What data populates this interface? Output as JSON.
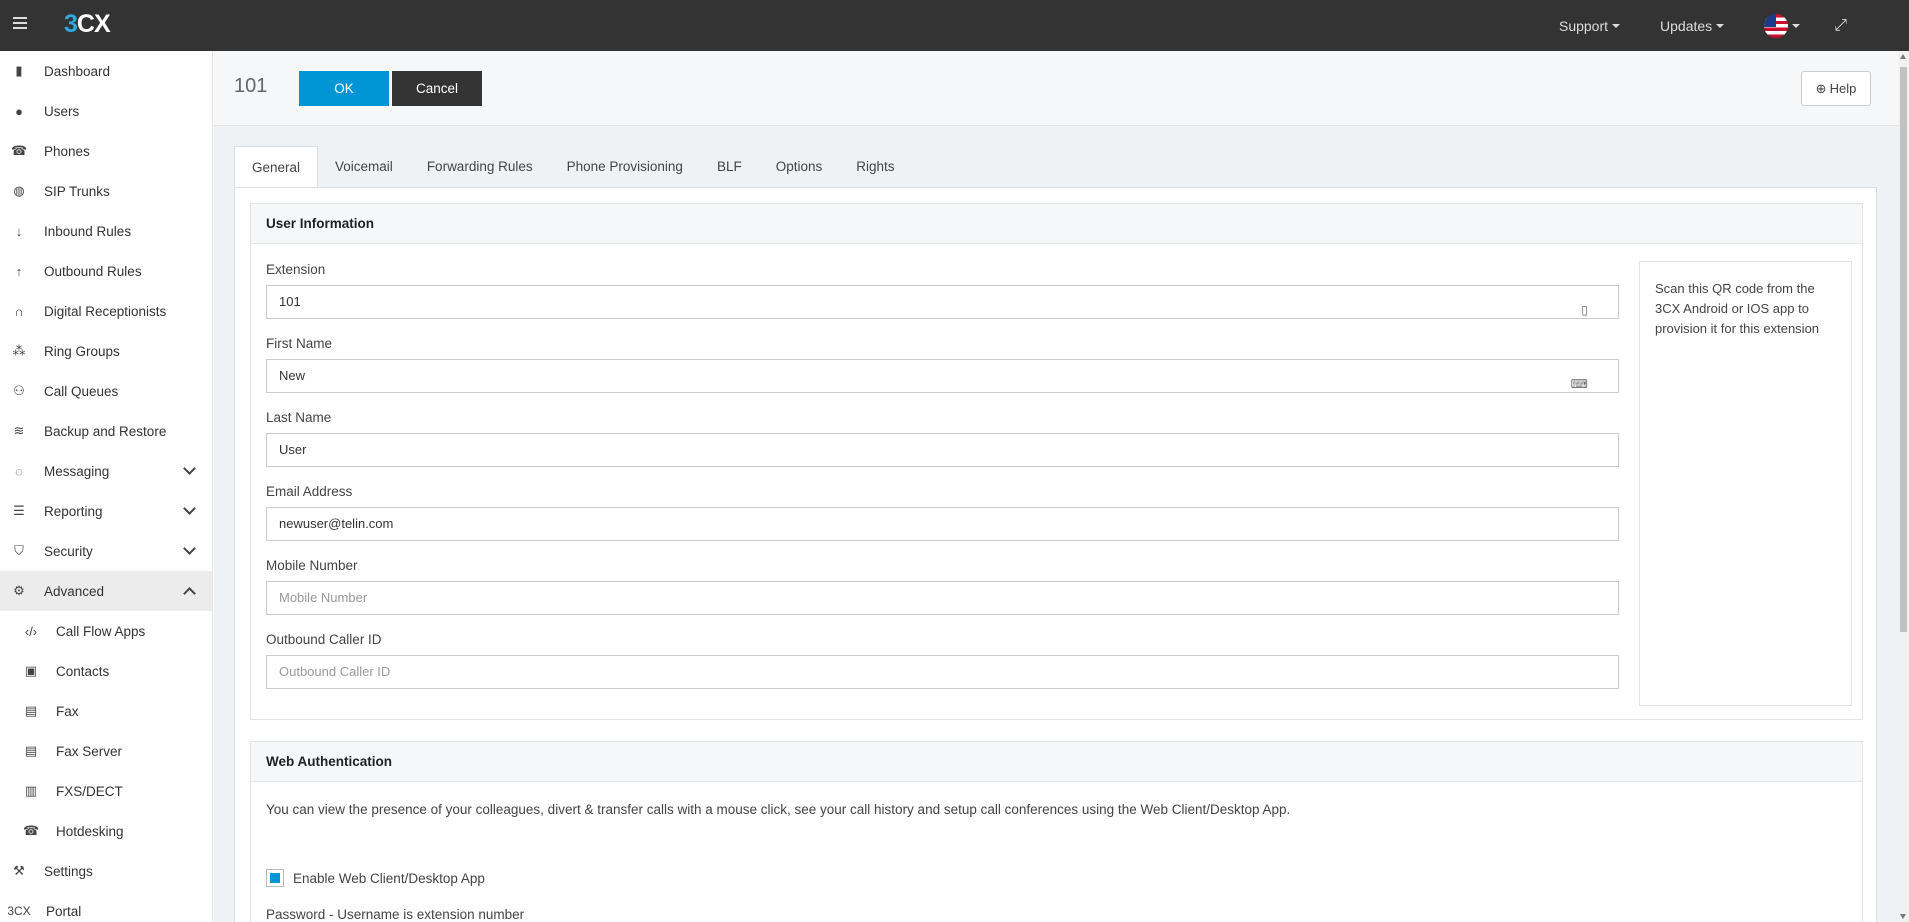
{
  "topbar": {
    "logo_prefix": "3",
    "logo_suffix": "CX",
    "support": "Support",
    "updates": "Updates"
  },
  "sidebar": {
    "items": [
      {
        "label": "Dashboard",
        "icon": "bar-chart-icon"
      },
      {
        "label": "Users",
        "icon": "user-icon"
      },
      {
        "label": "Phones",
        "icon": "phone-icon"
      },
      {
        "label": "SIP Trunks",
        "icon": "globe-icon"
      },
      {
        "label": "Inbound Rules",
        "icon": "arrow-down-icon"
      },
      {
        "label": "Outbound Rules",
        "icon": "arrow-up-icon"
      },
      {
        "label": "Digital Receptionists",
        "icon": "headset-icon"
      },
      {
        "label": "Ring Groups",
        "icon": "group-icon"
      },
      {
        "label": "Call Queues",
        "icon": "queue-icon"
      },
      {
        "label": "Backup and Restore",
        "icon": "database-icon"
      },
      {
        "label": "Messaging",
        "icon": "chat-icon"
      },
      {
        "label": "Reporting",
        "icon": "list-icon"
      },
      {
        "label": "Security",
        "icon": "shield-icon"
      },
      {
        "label": "Advanced",
        "icon": "gear-icon"
      },
      {
        "label": "Call Flow Apps",
        "icon": "code-icon"
      },
      {
        "label": "Contacts",
        "icon": "contact-book-icon"
      },
      {
        "label": "Fax",
        "icon": "fax-icon"
      },
      {
        "label": "Fax Server",
        "icon": "fax-server-icon"
      },
      {
        "label": "FXS/DECT",
        "icon": "fxs-icon"
      },
      {
        "label": "Hotdesking",
        "icon": "hotdesk-phone-icon"
      },
      {
        "label": "Settings",
        "icon": "wrench-icon"
      },
      {
        "label": "Portal",
        "icon": "3cx-logo-icon",
        "icon_text": "3CX"
      }
    ]
  },
  "header": {
    "title": "101",
    "ok": "OK",
    "cancel": "Cancel",
    "help": "Help"
  },
  "tabs": [
    "General",
    "Voicemail",
    "Forwarding Rules",
    "Phone Provisioning",
    "BLF",
    "Options",
    "Rights"
  ],
  "user_info": {
    "title": "User Information",
    "extension_label": "Extension",
    "extension_value": "101",
    "first_name_label": "First Name",
    "first_name_value": "New",
    "last_name_label": "Last Name",
    "last_name_value": "User",
    "email_label": "Email Address",
    "email_value": "newuser@telin.com",
    "mobile_label": "Mobile Number",
    "mobile_placeholder": "Mobile Number",
    "caller_id_label": "Outbound Caller ID",
    "caller_id_placeholder": "Outbound Caller ID",
    "qr_text": "Scan this QR code from the 3CX Android or IOS app to provision it for this extension"
  },
  "web_auth": {
    "title": "Web Authentication",
    "description": "You can view the presence of your colleagues, divert & transfer calls with a mouse click, see your call history and setup call conferences using the Web Client/Desktop App.",
    "enable_label": "Enable Web Client/Desktop App",
    "password_label": "Password - Username is extension number"
  }
}
